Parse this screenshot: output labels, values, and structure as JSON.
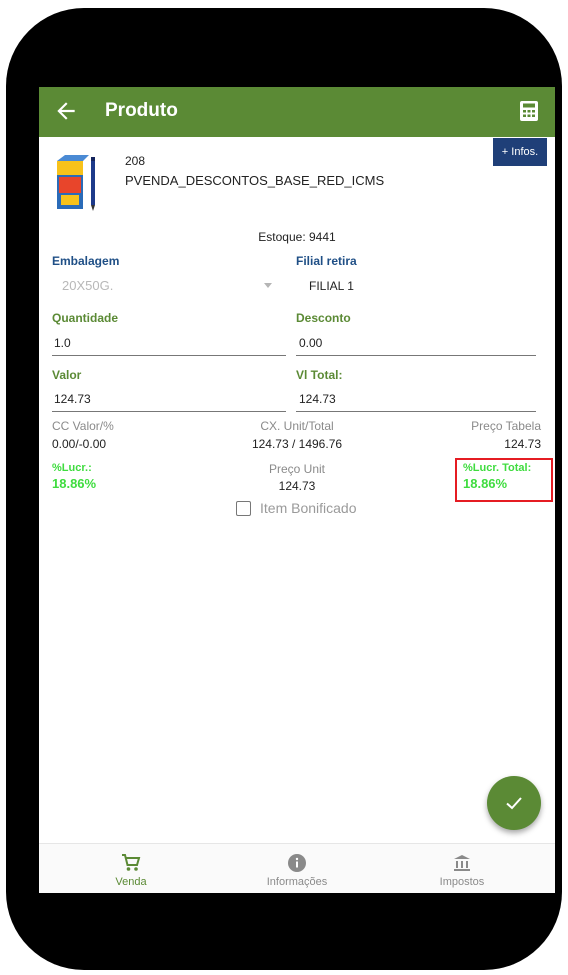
{
  "header": {
    "title": "Produto"
  },
  "product": {
    "infos_button": "+ Infos.",
    "code": "208",
    "name": "PVENDA_DESCONTOS_BASE_RED_ICMS",
    "stock": "Estoque: 9441"
  },
  "form": {
    "embalagem": {
      "label": "Embalagem",
      "value": "20X50G."
    },
    "filial": {
      "label": "Filial retira",
      "value": "FILIAL 1"
    },
    "quantidade": {
      "label": "Quantidade",
      "value": "1.0"
    },
    "desconto": {
      "label": "Desconto",
      "value": "0.00"
    },
    "valor": {
      "label": "Valor",
      "value": "124.73"
    },
    "vl_total": {
      "label": "Vl Total:",
      "value": "124.73"
    }
  },
  "summary": {
    "cc": {
      "label": "CC Valor/%",
      "value": "0.00/-0.00"
    },
    "cx": {
      "label": "CX. Unit/Total",
      "value": "124.73 / 1496.76"
    },
    "preco_tabela": {
      "label": "Preço Tabela",
      "value": "124.73"
    },
    "lucr": {
      "label": "%Lucr.:",
      "value": "18.86%"
    },
    "preco_unit": {
      "label": "Preço Unit",
      "value": "124.73"
    },
    "lucr_total": {
      "label": "%Lucr. Total:",
      "value": "18.86%"
    }
  },
  "item_bonificado": {
    "label": "Item Bonificado",
    "checked": false
  },
  "nav": {
    "items": [
      {
        "label": "Venda",
        "icon": "cart-icon",
        "active": true
      },
      {
        "label": "Informações",
        "icon": "info-icon",
        "active": false
      },
      {
        "label": "Impostos",
        "icon": "bank-icon",
        "active": false
      }
    ]
  },
  "colors": {
    "primary_green": "#5b8a35",
    "label_blue": "#1f4f86",
    "profit_green": "#3fdc3f",
    "highlight_red": "#e51c23",
    "infos_blue": "#1f3f78"
  }
}
